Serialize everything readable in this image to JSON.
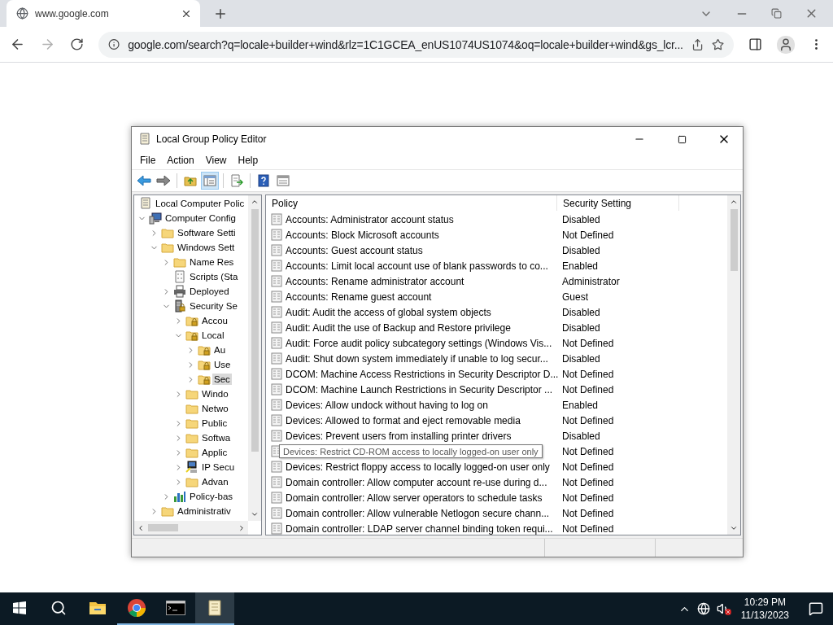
{
  "browser": {
    "tab": {
      "title": "www.google.com"
    },
    "address": "google.com/search?q=locale+builder+wind&rlz=1C1GCEA_enUS1074US1074&oq=locale+builder+wind&gs_lcr...",
    "forward_disabled": true
  },
  "window": {
    "title": "Local Group Policy Editor",
    "menu": [
      "File",
      "Action",
      "View",
      "Help"
    ],
    "toolbar": [
      {
        "kind": "back",
        "pressed": false
      },
      {
        "kind": "forward",
        "pressed": false
      },
      {
        "kind": "separator"
      },
      {
        "kind": "up",
        "pressed": false
      },
      {
        "kind": "tree",
        "pressed": true
      },
      {
        "kind": "separator"
      },
      {
        "kind": "export",
        "pressed": false
      },
      {
        "kind": "separator"
      },
      {
        "kind": "help",
        "pressed": false
      },
      {
        "kind": "view",
        "pressed": false
      }
    ],
    "tree": {
      "label": "Local Computer Polic",
      "kind": "doc",
      "children": [
        {
          "label": "Computer Config",
          "kind": "computer",
          "has_children": true,
          "expanded": true,
          "selected": false,
          "children": [
            {
              "label": "Software Setti",
              "kind": "folder",
              "has_children": true,
              "expanded": false,
              "selected": false
            },
            {
              "label": "Windows Sett",
              "kind": "folder",
              "has_children": true,
              "expanded": true,
              "selected": false,
              "children": [
                {
                  "label": "Name Res",
                  "kind": "folder",
                  "has_children": true,
                  "expanded": false,
                  "selected": false
                },
                {
                  "label": "Scripts (Sta",
                  "kind": "script",
                  "has_children": false,
                  "expanded": false,
                  "selected": false
                },
                {
                  "label": "Deployed",
                  "kind": "printer",
                  "has_children": true,
                  "expanded": false,
                  "selected": false
                },
                {
                  "label": "Security Se",
                  "kind": "server",
                  "has_children": true,
                  "expanded": true,
                  "selected": false,
                  "children": [
                    {
                      "label": "Accou",
                      "kind": "lockfolder",
                      "has_children": true,
                      "expanded": false,
                      "selected": false
                    },
                    {
                      "label": "Local",
                      "kind": "lockfolder",
                      "has_children": true,
                      "expanded": true,
                      "selected": false,
                      "children": [
                        {
                          "label": "Au",
                          "kind": "lockfolder",
                          "has_children": true,
                          "expanded": false,
                          "selected": false
                        },
                        {
                          "label": "Use",
                          "kind": "lockfolder",
                          "has_children": true,
                          "expanded": false,
                          "selected": false
                        },
                        {
                          "label": "Sec",
                          "kind": "lockfolder",
                          "has_children": true,
                          "expanded": false,
                          "selected": true
                        }
                      ]
                    },
                    {
                      "label": "Windo",
                      "kind": "folder",
                      "has_children": true,
                      "expanded": false,
                      "selected": false
                    },
                    {
                      "label": "Netwo",
                      "kind": "folder",
                      "has_children": false,
                      "expanded": false,
                      "selected": false
                    },
                    {
                      "label": "Public",
                      "kind": "folder",
                      "has_children": true,
                      "expanded": false,
                      "selected": false
                    },
                    {
                      "label": "Softwa",
                      "kind": "folder",
                      "has_children": true,
                      "expanded": false,
                      "selected": false
                    },
                    {
                      "label": "Applic",
                      "kind": "folder",
                      "has_children": true,
                      "expanded": false,
                      "selected": false
                    },
                    {
                      "label": "IP Secu",
                      "kind": "ipsec",
                      "has_children": true,
                      "expanded": false,
                      "selected": false
                    },
                    {
                      "label": "Advan",
                      "kind": "folder",
                      "has_children": true,
                      "expanded": false,
                      "selected": false
                    }
                  ]
                },
                {
                  "label": "Policy-bas",
                  "kind": "chart",
                  "has_children": true,
                  "expanded": false,
                  "selected": false
                }
              ]
            },
            {
              "label": "Administrativ",
              "kind": "folder",
              "has_children": true,
              "expanded": false,
              "selected": false
            }
          ]
        }
      ]
    },
    "list": {
      "columns": [
        "Policy",
        "Security Setting"
      ],
      "rows": [
        {
          "policy": "Accounts: Administrator account status",
          "setting": "Disabled"
        },
        {
          "policy": "Accounts: Block Microsoft accounts",
          "setting": "Not Defined"
        },
        {
          "policy": "Accounts: Guest account status",
          "setting": "Disabled"
        },
        {
          "policy": "Accounts: Limit local account use of blank passwords to co...",
          "setting": "Enabled"
        },
        {
          "policy": "Accounts: Rename administrator account",
          "setting": "Administrator"
        },
        {
          "policy": "Accounts: Rename guest account",
          "setting": "Guest"
        },
        {
          "policy": "Audit: Audit the access of global system objects",
          "setting": "Disabled"
        },
        {
          "policy": "Audit: Audit the use of Backup and Restore privilege",
          "setting": "Disabled"
        },
        {
          "policy": "Audit: Force audit policy subcategory settings (Windows Vis...",
          "setting": "Not Defined"
        },
        {
          "policy": "Audit: Shut down system immediately if unable to log secur...",
          "setting": "Disabled"
        },
        {
          "policy": "DCOM: Machine Access Restrictions in Security Descriptor D...",
          "setting": "Not Defined"
        },
        {
          "policy": "DCOM: Machine Launch Restrictions in Security Descriptor ...",
          "setting": "Not Defined"
        },
        {
          "policy": "Devices: Allow undock without having to log on",
          "setting": "Enabled"
        },
        {
          "policy": "Devices: Allowed to format and eject removable media",
          "setting": "Not Defined"
        },
        {
          "policy": "Devices: Prevent users from installing printer drivers",
          "setting": "Disabled"
        },
        {
          "setting": "Not Defined",
          "tooltip": "Devices: Restrict CD-ROM access to locally logged-on user only"
        },
        {
          "policy": "Devices: Restrict floppy access to locally logged-on user only",
          "setting": "Not Defined"
        },
        {
          "policy": "Domain controller: Allow computer account re-use during d...",
          "setting": "Not Defined"
        },
        {
          "policy": "Domain controller: Allow server operators to schedule tasks",
          "setting": "Not Defined"
        },
        {
          "policy": "Domain controller: Allow vulnerable Netlogon secure chann...",
          "setting": "Not Defined"
        },
        {
          "policy": "Domain controller: LDAP server channel binding token requi...",
          "setting": "Not Defined"
        }
      ]
    }
  },
  "taskbar": {
    "apps": [
      {
        "kind": "explorer",
        "running": false,
        "active": false
      },
      {
        "kind": "chrome",
        "running": true,
        "active": false
      },
      {
        "kind": "terminal",
        "running": true,
        "active": false
      },
      {
        "kind": "policy",
        "running": true,
        "active": true
      }
    ],
    "time": "10:29 PM",
    "date": "11/13/2023",
    "muted": true
  }
}
